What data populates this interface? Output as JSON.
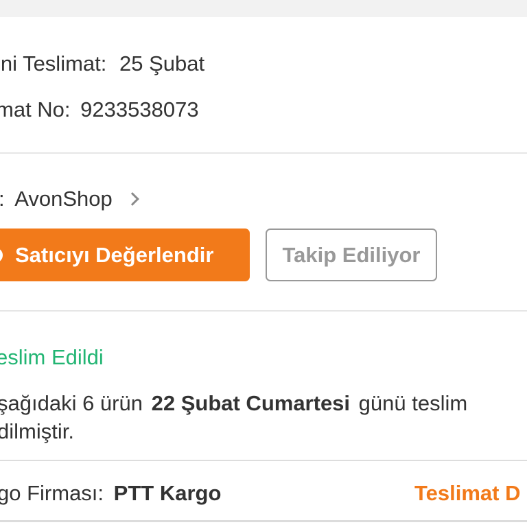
{
  "delivery_info": {
    "estimated_label": "ini Teslimat:",
    "estimated_value": "25 Şubat",
    "number_label": "mat No:",
    "number_value": "9233538073"
  },
  "seller": {
    "label": ":",
    "name": "AvonShop",
    "rate_button": "Satıcıyı Değerlendir",
    "follow_button": "Takip Ediliyor"
  },
  "status": {
    "title": "eslim Edildi",
    "message_prefix": "şağıdaki 6 ürün",
    "message_bold": "22 Şubat Cumartesi",
    "message_suffix": "günü teslim",
    "message_line2": "dilmiştir."
  },
  "shipping": {
    "carrier_label": "go Firması:",
    "carrier_value": "PTT Kargo",
    "detail_link": "Teslimat D"
  },
  "colors": {
    "accent": "#f27a1a",
    "success": "#22b573",
    "background": "#f2f2f2"
  }
}
